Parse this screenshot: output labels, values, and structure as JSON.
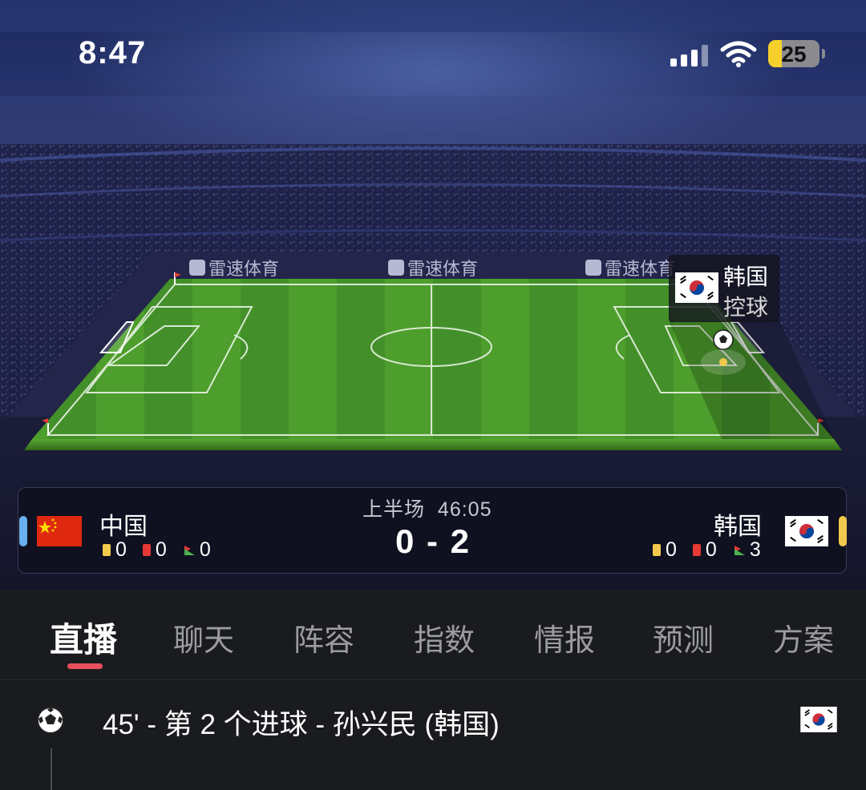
{
  "status_bar": {
    "time": "8:47",
    "battery": "25"
  },
  "watermark": "雷速体育",
  "possession": {
    "team": "韩国",
    "status": "控球"
  },
  "match": {
    "period": "上半场",
    "clock": "46:05",
    "score": "0 - 2",
    "home": {
      "name": "中国",
      "yellow": "0",
      "red": "0",
      "corners": "0",
      "color": "#6ab0f0"
    },
    "away": {
      "name": "韩国",
      "yellow": "0",
      "red": "0",
      "corners": "3",
      "color": "#f2c94c"
    }
  },
  "tabs": [
    {
      "label": "直播",
      "active": true
    },
    {
      "label": "聊天"
    },
    {
      "label": "阵容"
    },
    {
      "label": "指数"
    },
    {
      "label": "情报"
    },
    {
      "label": "预测"
    },
    {
      "label": "方案"
    }
  ],
  "events": [
    {
      "text": "45' - 第 2 个进球 - 孙兴民 (韩国)",
      "icon": "soccer-ball-icon",
      "team_flag": "korea-flag-icon"
    }
  ],
  "colors": {
    "accent": "#e8505b",
    "yellow_card": "#f2c94c",
    "red_card": "#e53935",
    "pitch": "#4a9a2a"
  }
}
